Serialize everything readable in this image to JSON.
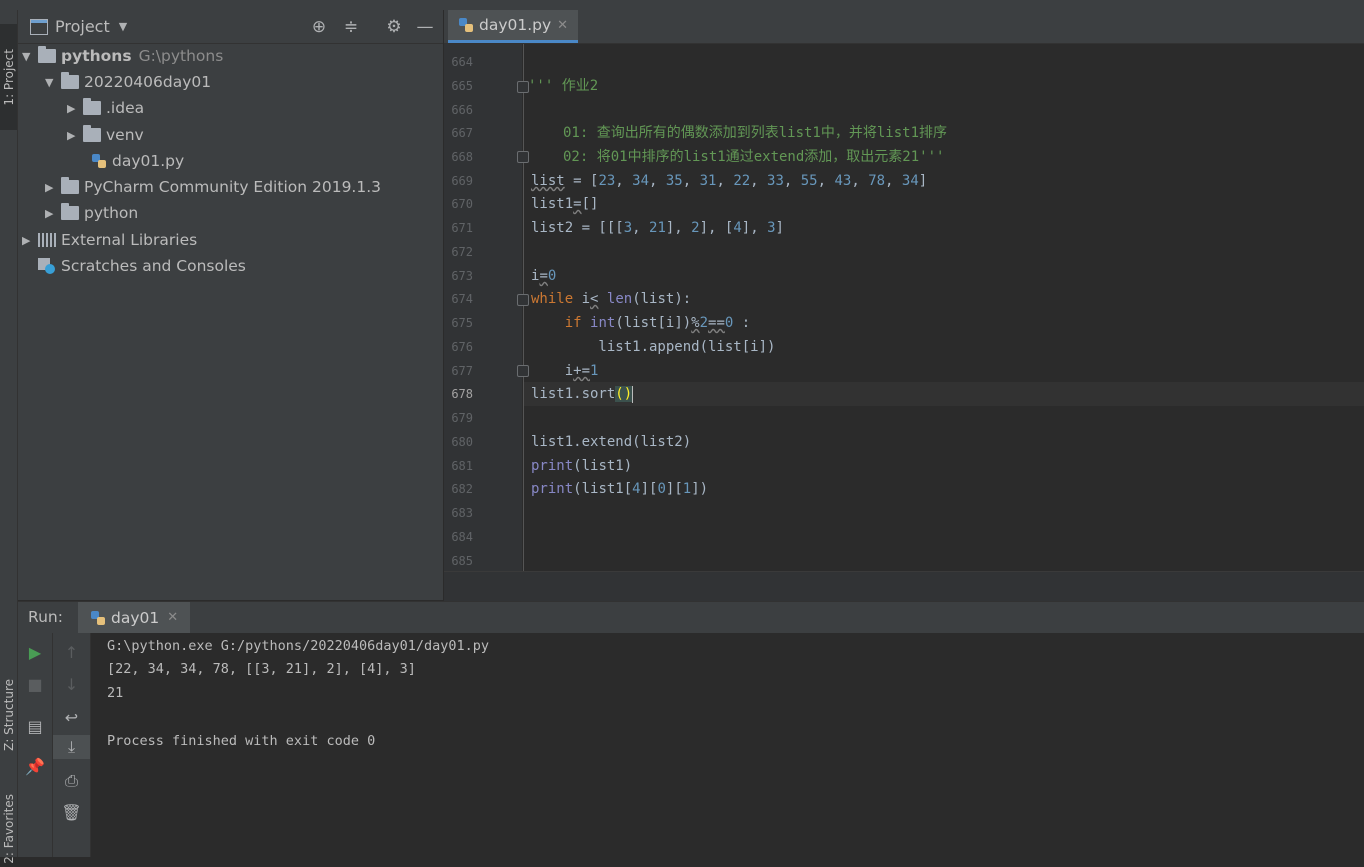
{
  "tool_stripes": {
    "project": "1: Project",
    "structure": "Z: Structure",
    "favorites": "2: Favorites"
  },
  "project_panel": {
    "title": "Project",
    "tree": [
      {
        "label": "pythons",
        "path": "G:\\pythons"
      },
      {
        "label": "20220406day01"
      },
      {
        "label": ".idea"
      },
      {
        "label": "venv"
      },
      {
        "label": "day01.py"
      },
      {
        "label": "PyCharm Community Edition 2019.1.3"
      },
      {
        "label": "python"
      },
      {
        "label": "External Libraries"
      },
      {
        "label": "Scratches and Consoles"
      }
    ]
  },
  "editor": {
    "tab_label": "day01.py",
    "current_line": "678",
    "line_numbers": [
      "664",
      "665",
      "666",
      "667",
      "668",
      "669",
      "670",
      "671",
      "672",
      "673",
      "674",
      "675",
      "676",
      "677",
      "678",
      "679",
      "680",
      "681",
      "682",
      "683",
      "684",
      "685"
    ],
    "comment_line1": "''' 作业2",
    "comment_line2": "01: 查询出所有的偶数添加到列表list1中，并将list1排序",
    "comment_line3": "02: 将01中排序的list1通过extend添加，取出元素21'''",
    "list_values": [
      "23",
      "34",
      "35",
      "31",
      "22",
      "33",
      "55",
      "43",
      "78",
      "34"
    ]
  },
  "run_panel": {
    "label": "Run:",
    "tab_label": "day01",
    "console_lines": [
      "G:\\python.exe G:/pythons/20220406day01/day01.py",
      "[22, 34, 34, 78, [[3, 21], 2], [4], 3]",
      "21",
      "",
      "Process finished with exit code 0"
    ]
  },
  "colors": {
    "background": "#2b2b2b",
    "panel": "#3c3f41",
    "keyword": "#cc7832",
    "number": "#6897bb",
    "builtin": "#8888c6",
    "comment": "#629755",
    "identifier": "#a9b7c6",
    "accent": "#4a88c7"
  }
}
